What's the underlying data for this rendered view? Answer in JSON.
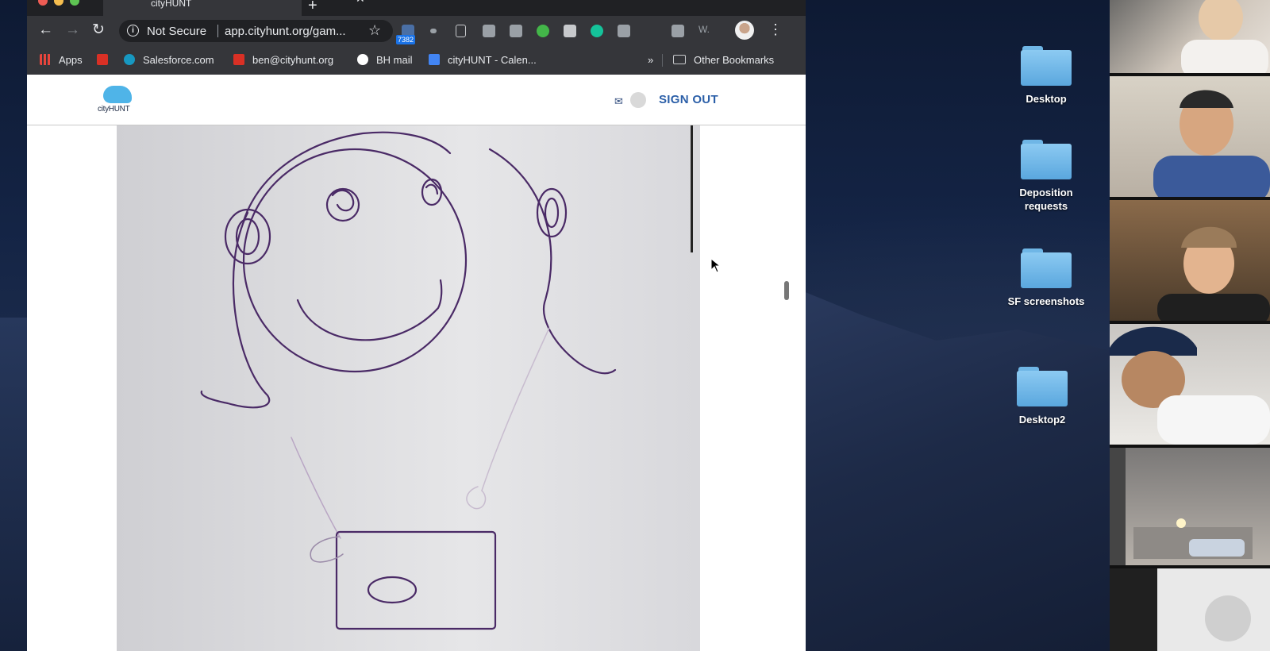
{
  "browser": {
    "tab_title": "cityHUNT",
    "address": {
      "security_text": "Not Secure",
      "url": "app.cityhunt.org/gam..."
    },
    "extension_badge": "7382",
    "bookmarks": [
      {
        "label": "Apps",
        "icon": "apps-grid-icon",
        "color": "#e8453c"
      },
      {
        "label": "Salesforce.com",
        "icon": "salesforce-cloud-icon",
        "color": "#1798c1"
      },
      {
        "label": "ben@cityhunt.org",
        "icon": "gmail-icon",
        "color": "#d93025"
      },
      {
        "label": "BH mail",
        "icon": "google-g-icon",
        "color": "#4285f4"
      },
      {
        "label": "cityHUNT - Calen...",
        "icon": "google-calendar-icon",
        "color": "#4285f4"
      }
    ],
    "bookmarks_overflow": "»",
    "other_bookmarks": "Other Bookmarks"
  },
  "site": {
    "logo_text": "cityHUNT",
    "sign_out": "SIGN OUT",
    "accent": "#2b5fa8"
  },
  "desktop_icons": [
    {
      "label": "Desktop",
      "icon": "folder-icon"
    },
    {
      "label": "Deposition requests",
      "icon": "folder-icon"
    },
    {
      "label": "SF screenshots",
      "icon": "folder-icon"
    },
    {
      "label": "Desktop2",
      "icon": "folder-icon"
    }
  ],
  "video_participants": [
    {
      "name": "",
      "icon": "participant-video-icon"
    },
    {
      "name": "",
      "icon": "participant-video-icon"
    },
    {
      "name": "",
      "icon": "participant-video-icon"
    },
    {
      "name": "",
      "icon": "participant-video-icon"
    },
    {
      "name": "",
      "icon": "participant-video-icon"
    },
    {
      "name": "",
      "icon": "participant-placeholder-icon"
    }
  ]
}
